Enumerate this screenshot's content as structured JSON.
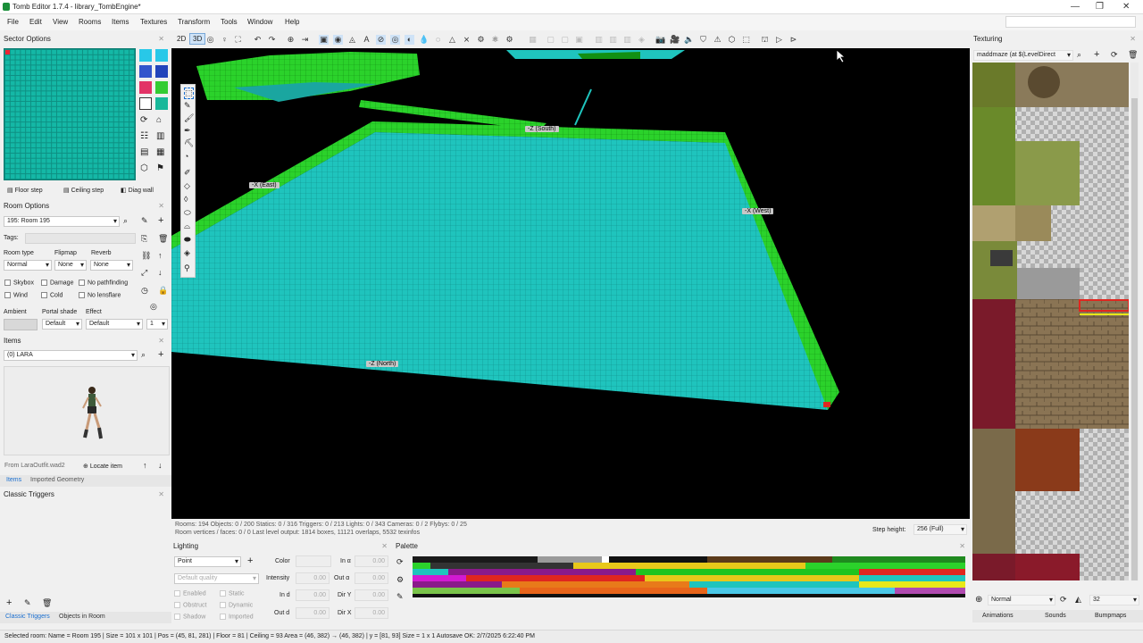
{
  "window": {
    "title": "Tomb Editor 1.7.4 - library_TombEngine*",
    "controls": [
      "—",
      "❐",
      "✕"
    ]
  },
  "menu": [
    "File",
    "Edit",
    "View",
    "Rooms",
    "Items",
    "Textures",
    "Transform",
    "Tools",
    "Window",
    "Help"
  ],
  "sector_options": {
    "title": "Sector Options",
    "buttons": {
      "floor_step": "Floor step",
      "ceiling_step": "Ceiling step",
      "diag_wall": "Diag wall"
    }
  },
  "room_options": {
    "title": "Room Options",
    "room_selector": "195: Room 195",
    "tags_label": "Tags:",
    "room_type_label": "Room type",
    "room_type_value": "Normal",
    "flipmap_label": "Flipmap",
    "flipmap_value": "None",
    "reverb_label": "Reverb",
    "reverb_value": "None",
    "checks": [
      "Skybox",
      "Damage",
      "No pathfinding",
      "Wind",
      "Cold",
      "No lensflare"
    ],
    "ambient_label": "Ambient",
    "portal_shade_label": "Portal shade",
    "portal_shade_value": "Default",
    "effect_label": "Effect",
    "effect_value": "Default",
    "effect_num": "1"
  },
  "items": {
    "title": "Items",
    "selected": "(0) LARA",
    "from": "From LaraOutfit.wad2",
    "locate": "Locate item",
    "tabs": [
      "Items",
      "Imported Geometry"
    ]
  },
  "triggers": {
    "title": "Classic Triggers",
    "tabs": [
      "Classic Triggers",
      "Objects in Room"
    ]
  },
  "toolbar": {
    "mode_2d": "2D",
    "mode_3d": "3D"
  },
  "viewport": {
    "labels": {
      "south": "-Z (South)",
      "east": "-X (East)",
      "west": "-X (West)",
      "north": "-Z (North)"
    },
    "stats_line1": "Rooms: 194  Objects: 0 / 200  Statics: 0 / 316  Triggers: 0 / 213  Lights: 0 / 343  Cameras: 0 / 2  Flybys: 0 / 25",
    "stats_line2": "Room vertices / faces: 0 / 0  Last level output: 1814 boxes, 11121 overlaps, 5532 texinfos",
    "step_height_label": "Step height:",
    "step_height_value": "256 (Full)"
  },
  "lighting": {
    "title": "Lighting",
    "type": "Point",
    "quality": "Default quality",
    "color_label": "Color",
    "intensity_label": "Intensity",
    "in_d_label": "In d",
    "out_d_label": "Out d",
    "in_a_label": "In α",
    "out_a_label": "Out α",
    "dir_y_label": "Dir Y",
    "dir_x_label": "Dir X",
    "zero": "0.00",
    "checks": [
      "Enabled",
      "Static",
      "Obstruct",
      "Dynamic",
      "Shadow",
      "Imported"
    ]
  },
  "palette": {
    "title": "Palette"
  },
  "texturing": {
    "title": "Texturing",
    "file": "maddmaze (at $(LevelDirect",
    "blend": "Normal",
    "size": "32",
    "tabs": [
      "Animations",
      "Sounds",
      "Bumpmaps"
    ]
  },
  "status": {
    "text": "Selected room: Name = Room 195 | Size = 101 x 101 | Pos = (45, 81, 281) | Floor = 81 | Ceiling = 93    Area = (46, 382) → (46, 382) | y = [81, 93]    Size = 1 x 1    Autosave OK: 2/7/2025 6:22:40 PM"
  },
  "colors": {
    "floor_cyan": "#1fc4bd",
    "wall_green": "#2bd22b",
    "sector_cyan": "#14b8a6",
    "accent_blue": "#1a6fd0"
  }
}
